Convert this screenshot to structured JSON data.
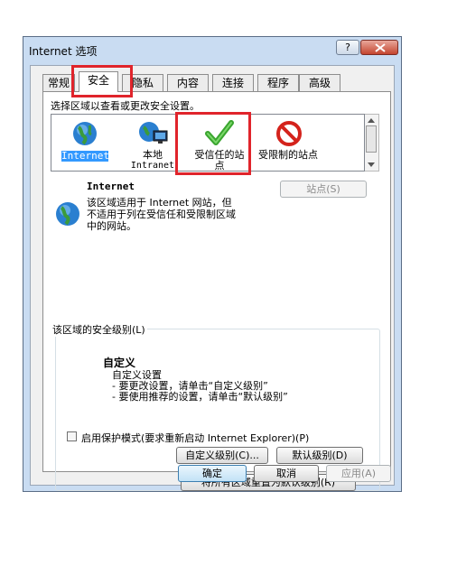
{
  "window": {
    "title": "Internet 选项",
    "help_label": "?"
  },
  "tabs": [
    {
      "label": "常规"
    },
    {
      "label": "安全"
    },
    {
      "label": "隐私"
    },
    {
      "label": "内容"
    },
    {
      "label": "连接"
    },
    {
      "label": "程序"
    },
    {
      "label": "高级"
    }
  ],
  "security": {
    "zone_prompt": "选择区域以查看或更改安全设置。",
    "zones": [
      {
        "label": "Internet",
        "icon": "globe-icon"
      },
      {
        "label_line1": "本地",
        "label_line2": "Intranet",
        "icon": "local-intranet-icon"
      },
      {
        "label_line1": "受信任的站",
        "label_line2": "点",
        "icon": "trusted-sites-check-icon"
      },
      {
        "label": "受限制的站点",
        "icon": "restricted-sites-icon"
      }
    ],
    "selected_zone": {
      "name": "Internet",
      "desc_line1": "该区域适用于 Internet 网站，但",
      "desc_line2": "不适用于列在受信任和受限制区域",
      "desc_line3": "中的网站。"
    },
    "sites_button": "站点(S)",
    "level_group_label": "该区域的安全级别(L)",
    "level": {
      "title": "自定义",
      "line1": "自定义设置",
      "line2": "- 要更改设置，请单击“自定义级别”",
      "line3": "- 要使用推荐的设置，请单击“默认级别”"
    },
    "protected_mode_label": "启用保护模式(要求重新启动 Internet Explorer)(P)",
    "protected_mode_checked": false,
    "custom_level_button": "自定义级别(C)...",
    "default_level_button": "默认级别(D)",
    "reset_all_button": "将所有区域重置为默认级别(R)"
  },
  "footer": {
    "ok": "确定",
    "cancel": "取消",
    "apply": "应用(A)"
  },
  "colors": {
    "highlight": "#e0242b",
    "title_bar": "#c9dcf2",
    "selection": "#3399ff"
  }
}
